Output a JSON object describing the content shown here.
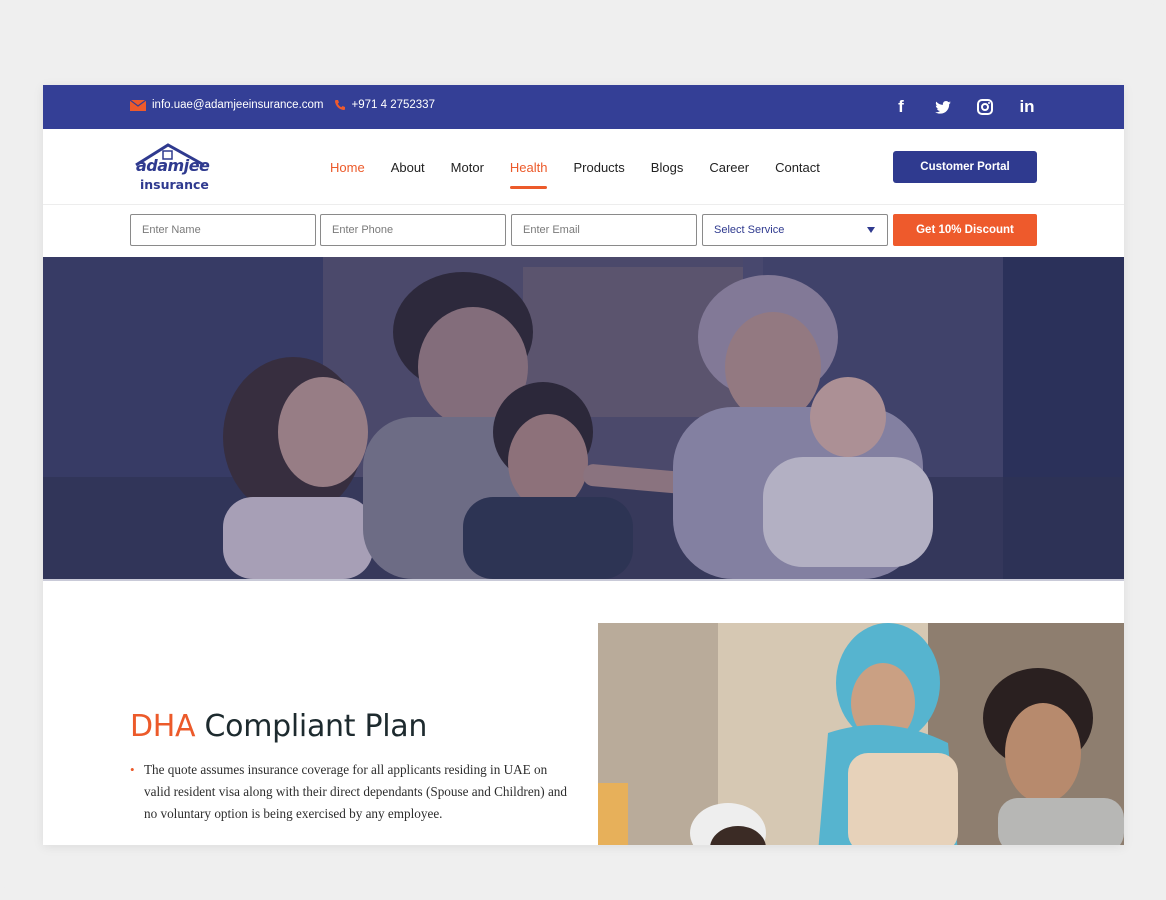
{
  "topbar": {
    "email": "info.uae@adamjeeinsurance.com",
    "phone": "+971 4 2752337",
    "social": [
      "facebook-icon",
      "twitter-icon",
      "instagram-icon",
      "linkedin-icon"
    ],
    "social_labels": {
      "facebook": "f",
      "linkedin": "in"
    }
  },
  "logo": {
    "line1": "adamjee",
    "line2": "insurance"
  },
  "nav": {
    "items": [
      {
        "label": "Home"
      },
      {
        "label": "About"
      },
      {
        "label": "Motor"
      },
      {
        "label": "Health"
      },
      {
        "label": "Products"
      },
      {
        "label": "Blogs"
      },
      {
        "label": "Career"
      },
      {
        "label": "Contact"
      }
    ],
    "portal_button": "Customer Portal"
  },
  "quote_form": {
    "name_placeholder": "Enter Name",
    "phone_placeholder": "Enter Phone",
    "email_placeholder": "Enter Email",
    "service_selected": "Select Service",
    "submit_label": "Get 10% Discount"
  },
  "section": {
    "heading_accent": "DHA",
    "heading_rest": " Compliant Plan",
    "bullet": "The quote assumes insurance coverage for all applicants residing in UAE on valid resident visa along with their direct dependants (Spouse and Children) and no voluntary option is being exercised by any employee."
  },
  "colors": {
    "brand_blue": "#343f96",
    "accent_orange": "#ec5a2a"
  }
}
